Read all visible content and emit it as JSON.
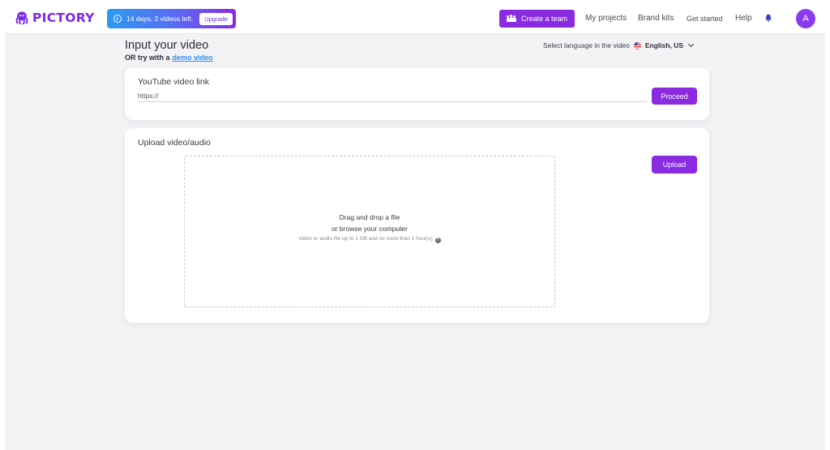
{
  "header": {
    "brand": "PICTORY",
    "trial_text": "14 days, 2 videos left.",
    "upgrade_label": "Upgrade",
    "create_team_label": "Create a team",
    "nav": [
      "My projects",
      "Brand kits",
      "Get started",
      "Help"
    ],
    "avatar_initial": "A"
  },
  "main": {
    "title": "Input your video",
    "demo_prefix": "OR try with a",
    "demo_link": "demo video",
    "language_label": "Select language in the video",
    "language_value": "English, US"
  },
  "youtube": {
    "title": "YouTube video link",
    "input_value": "https://",
    "proceed_label": "Proceed"
  },
  "upload": {
    "title": "Upload video/audio",
    "upload_label": "Upload",
    "drop_line1": "Drag and drop a file",
    "drop_line2": "or browse your computer",
    "drop_hint": "Video or audio file up to 1 GB and no more than 1 hour(s)",
    "help_glyph": "?"
  },
  "colors": {
    "accent": "#8a2be2",
    "link": "#2f8ff0",
    "background": "#f3f3f6"
  }
}
